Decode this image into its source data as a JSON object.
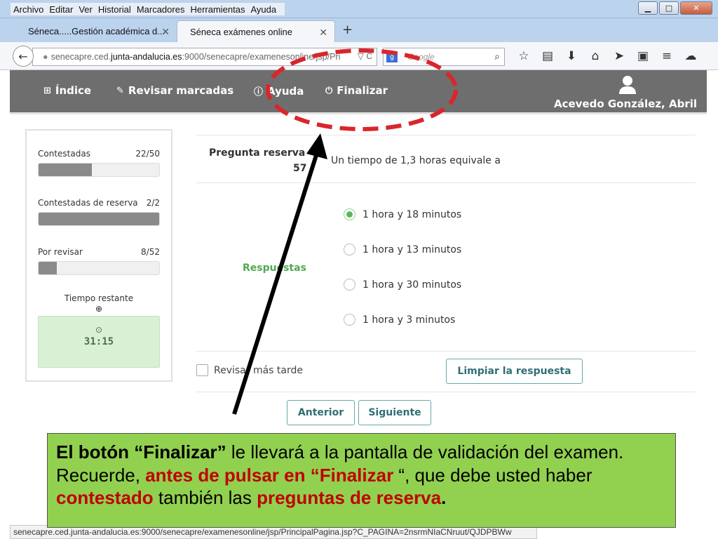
{
  "menu": [
    "Archivo",
    "Editar",
    "Ver",
    "Historial",
    "Marcadores",
    "Herramientas",
    "Ayuda"
  ],
  "tabs": [
    {
      "label": "Séneca.....Gestión académica d...",
      "active": false
    },
    {
      "label": "Séneca exámenes online",
      "active": true
    }
  ],
  "address": {
    "pre": "senecapre.ced.",
    "domain": "junta-andalucia.es",
    "post": ":9000/senecapre/examenesonline/jsp/Pri"
  },
  "search": {
    "placeholder": "Google"
  },
  "header": {
    "nav": [
      "Índice",
      "Revisar marcadas",
      "Ayuda",
      "Finalizar"
    ],
    "user": "Acevedo González, Abril"
  },
  "stats": [
    {
      "label": "Contestadas",
      "count": "22/50",
      "fraction": 0.44
    },
    {
      "label": "Contestadas de reserva",
      "count": "2/2",
      "fraction": 1.0
    },
    {
      "label": "Por revisar",
      "count": "8/52",
      "fraction": 0.15
    }
  ],
  "time": {
    "label": "Tiempo restante",
    "value": "31:15"
  },
  "question": {
    "heading": "Pregunta reserva",
    "number": "57",
    "text": "Un tiempo de 1,3 horas equivale a",
    "responses_label": "Respuestas",
    "options": [
      "1 hora y 18 minutos",
      "1 hora y 13 minutos",
      "1 hora y 30 minutos",
      "1 hora y 3 minutos"
    ],
    "selected_index": 0,
    "review_label": "Revisar más tarde",
    "clear_label": "Limpiar la respuesta"
  },
  "buttons": {
    "prev": "Anterior",
    "next": "Siguiente"
  },
  "status_url": "senecapre.ced.junta-andalucia.es:9000/senecapre/examenesonline/jsp/PrincipalPagina.jsp?C_PAGINA=2nsrmNIaCNruut/QJDPBWw",
  "callout": {
    "p1": "El botón “Finalizar”",
    "p2": " le llevará a la pantalla de validación del examen. Recuerde, ",
    "p3": "antes de pulsar en “Finalizar",
    "p4": " “, que debe usted haber ",
    "p5": "contestado",
    "p6": " también las ",
    "p7": "preguntas de reserva",
    "p8": "."
  },
  "colors": {
    "annotation_red": "#d9262c",
    "callout_bg": "#92d050",
    "accent_green": "#5cb85c"
  }
}
